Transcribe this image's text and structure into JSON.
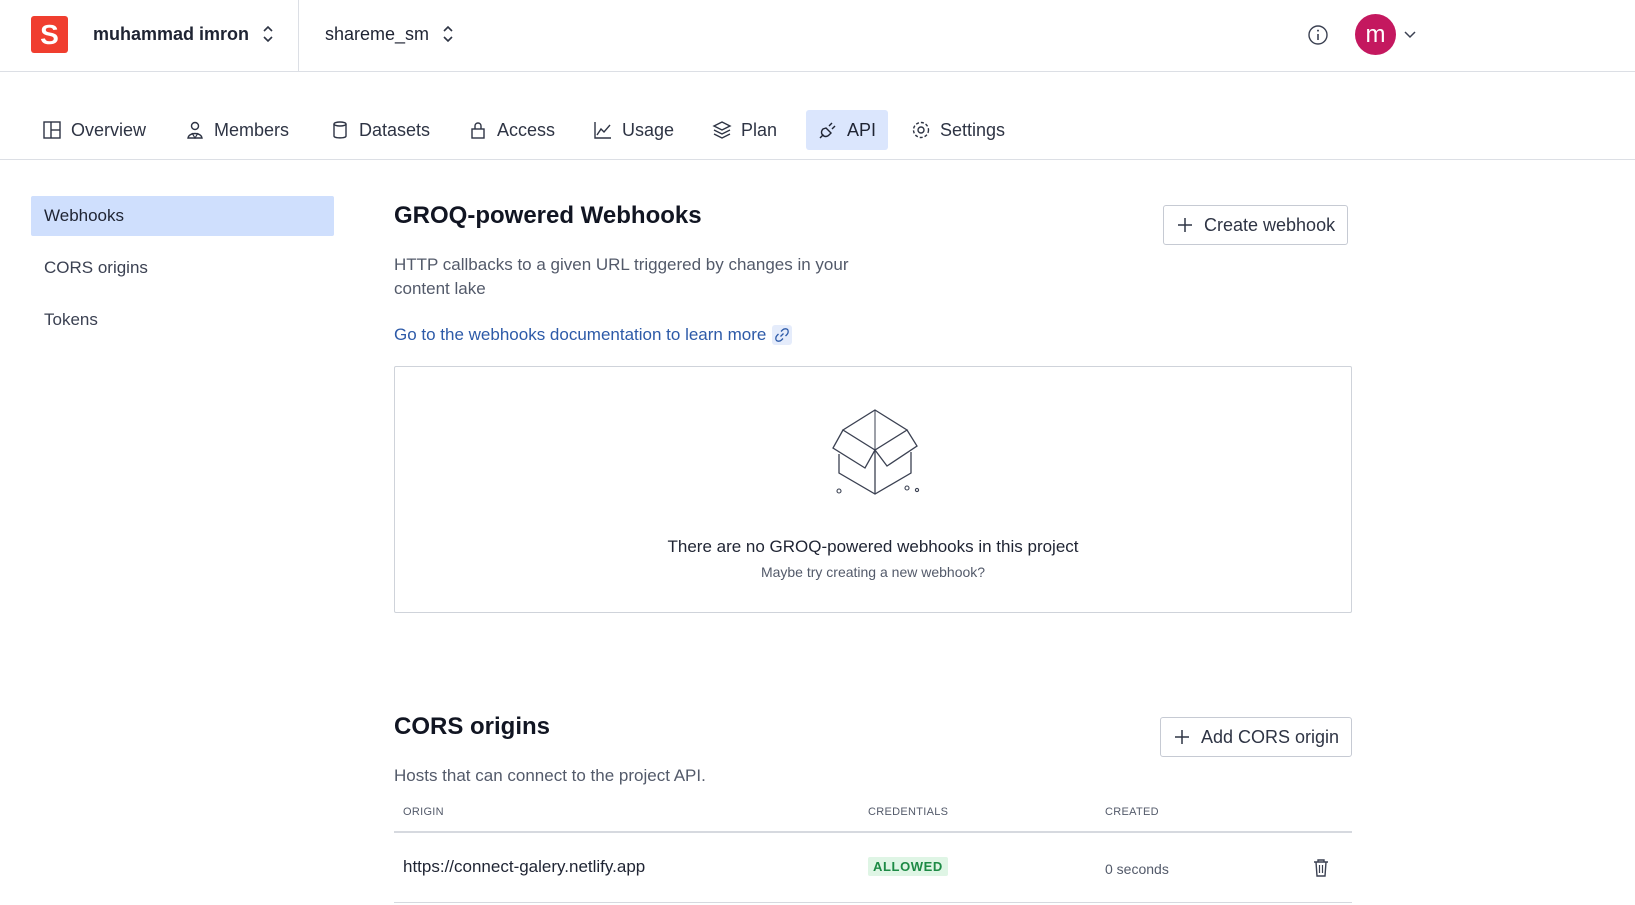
{
  "header": {
    "logo_letter": "S",
    "org_name": "muhammad imron",
    "project_name": "shareme_sm",
    "avatar_letter": "m",
    "colors": {
      "logo": "#f03e2f",
      "avatar": "#c4185f"
    }
  },
  "tabs": [
    {
      "label": "Overview",
      "icon": "overview-icon"
    },
    {
      "label": "Members",
      "icon": "members-icon"
    },
    {
      "label": "Datasets",
      "icon": "datasets-icon"
    },
    {
      "label": "Access",
      "icon": "lock-icon"
    },
    {
      "label": "Usage",
      "icon": "usage-chart-icon"
    },
    {
      "label": "Plan",
      "icon": "layers-icon"
    },
    {
      "label": "API",
      "icon": "plug-icon",
      "active": true
    },
    {
      "label": "Settings",
      "icon": "gear-icon"
    }
  ],
  "sidebar": {
    "items": [
      {
        "label": "Webhooks",
        "active": true
      },
      {
        "label": "CORS origins"
      },
      {
        "label": "Tokens"
      }
    ]
  },
  "webhooks": {
    "title": "GROQ-powered Webhooks",
    "description": "HTTP callbacks to a given URL triggered by changes in your content lake",
    "create_button": "Create webhook",
    "doc_link": "Go to the webhooks documentation to learn more",
    "empty_title": "There are no GROQ-powered webhooks in this project",
    "empty_subtitle": "Maybe try creating a new webhook?"
  },
  "cors": {
    "title": "CORS origins",
    "description": "Hosts that can connect to the project API.",
    "add_button": "Add CORS origin",
    "columns": [
      "ORIGIN",
      "CREDENTIALS",
      "CREATED"
    ],
    "rows": [
      {
        "origin": "https://connect-galery.netlify.app",
        "credentials": "ALLOWED",
        "created": "0 seconds"
      }
    ]
  }
}
